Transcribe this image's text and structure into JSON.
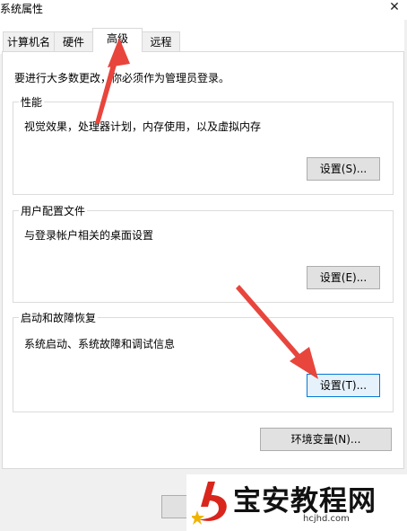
{
  "window": {
    "title": "系统属性",
    "close_glyph": "✕"
  },
  "tabs": [
    {
      "label": "计算机名"
    },
    {
      "label": "硬件"
    },
    {
      "label": "高级"
    },
    {
      "label": "远程"
    }
  ],
  "intro_text": "要进行大多数更改，你必须作为管理员登录。",
  "performance": {
    "label": "性能",
    "description": "视觉效果，处理器计划，内存使用，以及虚拟内存",
    "button": "设置(S)..."
  },
  "user_profiles": {
    "label": "用户配置文件",
    "description": "与登录帐户相关的桌面设置",
    "button": "设置(E)..."
  },
  "startup_recovery": {
    "label": "启动和故障恢复",
    "description": "系统启动、系统故障和调试信息",
    "button": "设置(T)..."
  },
  "env_button": "环境变量(N)...",
  "watermark": {
    "text": "宝安教程网",
    "url": "hcjhd.com"
  },
  "colors": {
    "arrow": "#e8453c",
    "focus_border": "#0078d7",
    "logo_red": "#d9261c",
    "logo_yellow": "#f0b400"
  }
}
